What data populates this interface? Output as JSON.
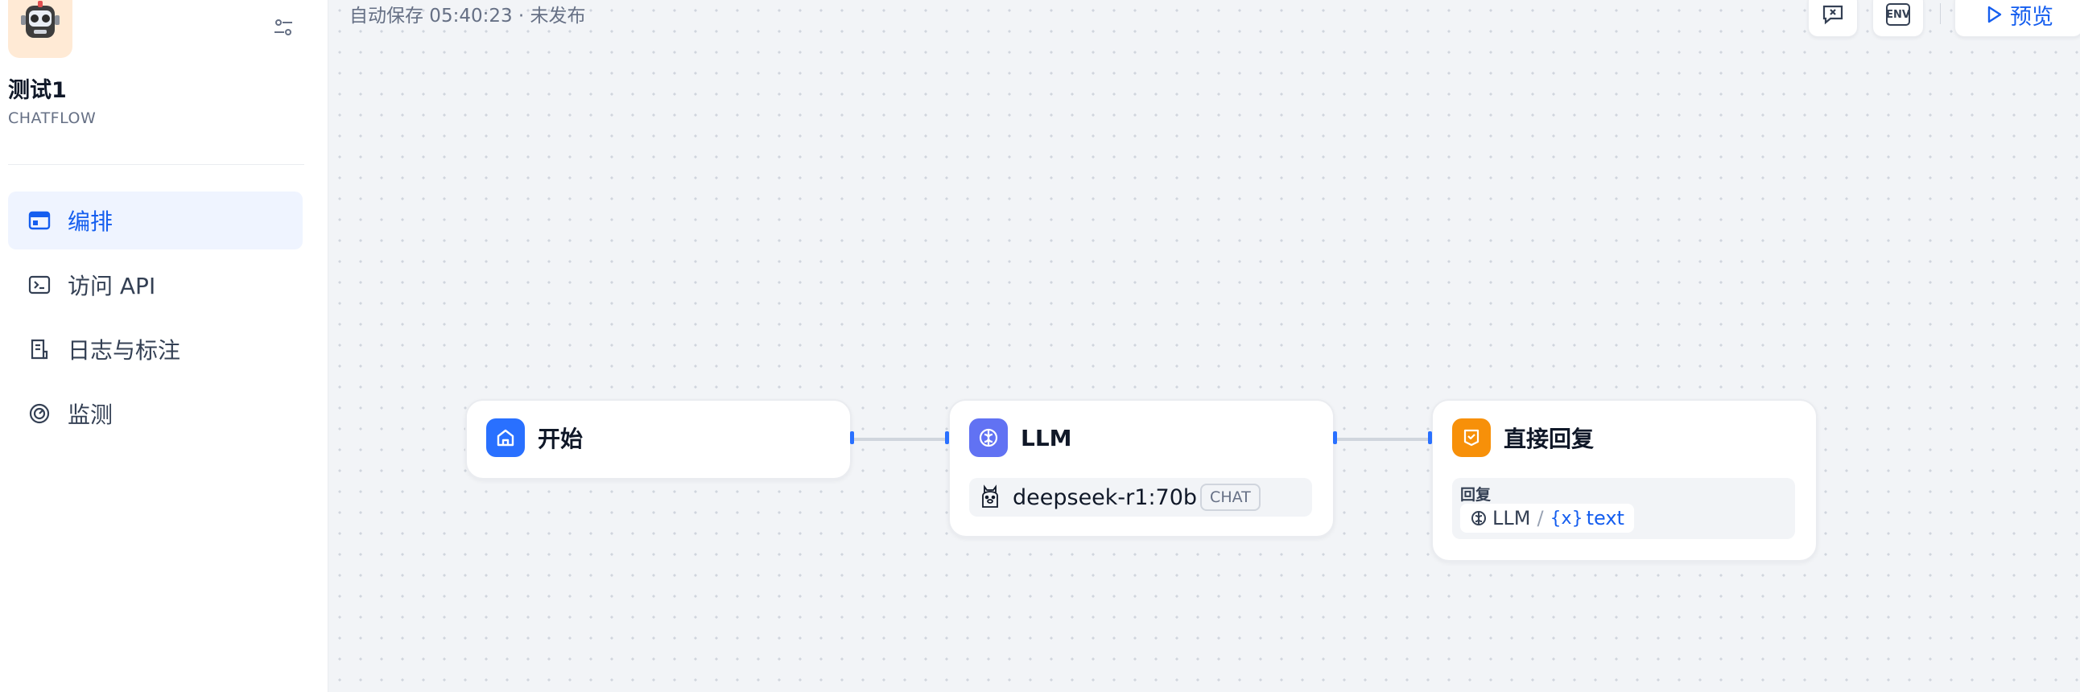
{
  "app": {
    "name": "测试1",
    "mode": "CHATFLOW"
  },
  "nav": [
    {
      "label": "编排",
      "icon": "window-icon",
      "active": true
    },
    {
      "label": "访问 API",
      "icon": "terminal-icon",
      "active": false
    },
    {
      "label": "日志与标注",
      "icon": "document-icon",
      "active": false
    },
    {
      "label": "监测",
      "icon": "gauge-icon",
      "active": false
    }
  ],
  "header": {
    "autosave": "自动保存 05:40:23 · 未发布",
    "preview_label": "预览",
    "env_label": "ENV"
  },
  "nodes": {
    "start": {
      "title": "开始"
    },
    "llm": {
      "title": "LLM",
      "model": "deepseek-r1:70b",
      "badge": "CHAT"
    },
    "answer": {
      "title": "直接回复",
      "field_label": "回复",
      "var_node": "LLM",
      "var_sep": "/",
      "var_prefix": "{x}",
      "var_name": "text"
    }
  },
  "colors": {
    "accent": "#155eef",
    "start_icon_bg": "#2970ff",
    "llm_icon_bg": "#6172f3",
    "answer_icon_bg": "#f79009",
    "app_icon_bg": "#ffead5"
  }
}
